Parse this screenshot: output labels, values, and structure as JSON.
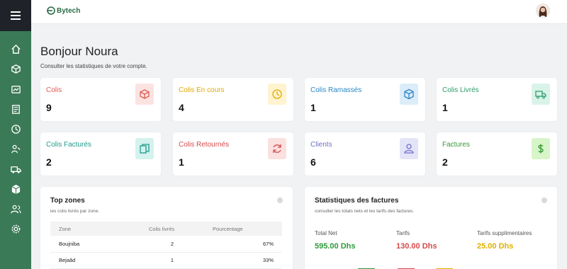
{
  "brand": {
    "name": "Bytech"
  },
  "header": {
    "title": "Bonjour Noura",
    "subtitle": "Consulter les statistiques de votre compte."
  },
  "sidebar": {
    "items": [
      {
        "icon": "home-icon"
      },
      {
        "icon": "box-icon"
      },
      {
        "icon": "chart-icon"
      },
      {
        "icon": "invoice-icon"
      },
      {
        "icon": "clock-icon"
      },
      {
        "icon": "person-delivery-icon"
      },
      {
        "icon": "truck-icon"
      },
      {
        "icon": "package-icon"
      },
      {
        "icon": "users-icon"
      },
      {
        "icon": "settings-icon"
      }
    ]
  },
  "cards": [
    {
      "label": "Colis",
      "value": "9",
      "color": "#e05a4f",
      "bg": "#fbe3e1",
      "icon": "box-icon"
    },
    {
      "label": "Colis En cours",
      "value": "4",
      "color": "#e0a800",
      "bg": "#fff4cf",
      "icon": "clock-icon"
    },
    {
      "label": "Colis Ramassés",
      "value": "1",
      "color": "#2a86c7",
      "bg": "#dcecf8",
      "icon": "cube-icon"
    },
    {
      "label": "Colis Livrés",
      "value": "1",
      "color": "#2f9b6c",
      "bg": "#d9f3e8",
      "icon": "truck-icon"
    },
    {
      "label": "Colis Facturés",
      "value": "2",
      "color": "#1f9a8a",
      "bg": "#d4f2ee",
      "icon": "documents-icon"
    },
    {
      "label": "Colis Retournés",
      "value": "1",
      "color": "#d44a4a",
      "bg": "#fbe0e0",
      "icon": "refresh-icon"
    },
    {
      "label": "Clients",
      "value": "6",
      "color": "#6f6fc9",
      "bg": "#e4e4f8",
      "icon": "user-icon"
    },
    {
      "label": "Factures",
      "value": "2",
      "color": "#3a9a3a",
      "bg": "#d7f5c9",
      "icon": "dollar-icon"
    }
  ],
  "top_zones": {
    "title": "Top zones",
    "subtitle": "les colis livrés par zone.",
    "columns": [
      "Zone",
      "Colis livrés",
      "Pourcentage"
    ],
    "rows": [
      [
        "Boujniba",
        "2",
        "67%"
      ],
      [
        "Bejaâd",
        "1",
        "33%"
      ]
    ]
  },
  "invoice_stats": {
    "title": "Statistiques des factures",
    "subtitle": "consulter les totals nets et les tarifs des factures.",
    "stats": [
      {
        "label": "Total Net",
        "value": "595.00 Dhs",
        "color": "#2e9b3a"
      },
      {
        "label": "Tarifs",
        "value": "130.00 Dhs",
        "color": "#d44a4a"
      },
      {
        "label": "Tarifs supplimentaires",
        "value": "25.00 Dhs",
        "color": "#e0b000"
      }
    ]
  }
}
